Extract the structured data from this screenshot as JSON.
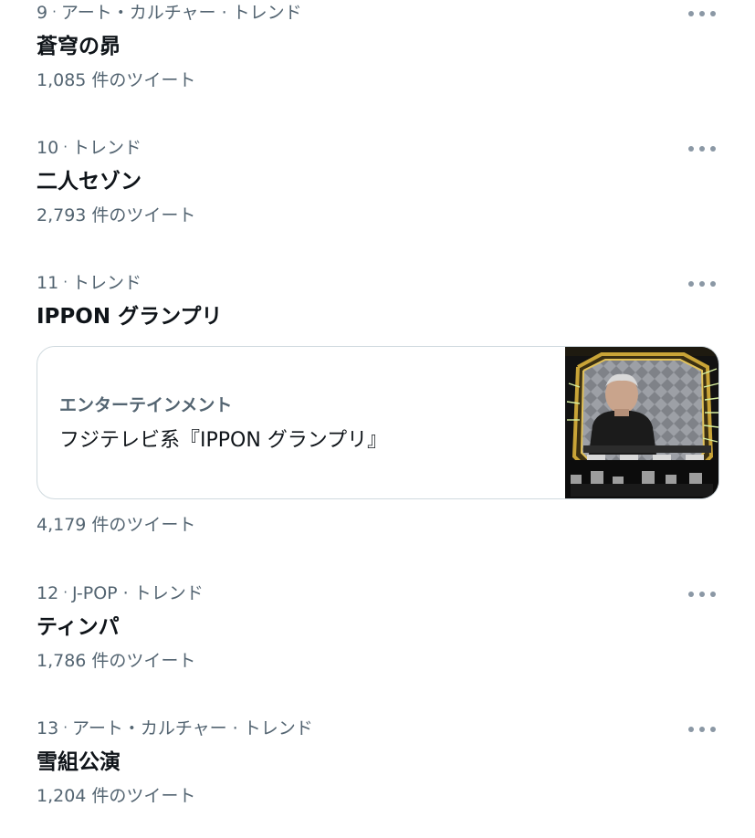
{
  "trends": [
    {
      "rank": "9",
      "category": "アート・カルチャー · トレンド",
      "name": "蒼穹の昴",
      "count": "1,085 件のツイート"
    },
    {
      "rank": "10",
      "category": "トレンド",
      "name": "二人セゾン",
      "count": "2,793 件のツイート"
    },
    {
      "rank": "11",
      "category": "トレンド",
      "name": "IPPON グランプリ",
      "card": {
        "category": "エンターテインメント",
        "title": "フジテレビ系『IPPON グランプリ』",
        "thumbnail": "tv-show-host-photo"
      },
      "count": "4,179 件のツイート"
    },
    {
      "rank": "12",
      "category": "J-POP · トレンド",
      "name": "ティンパ",
      "count": "1,786 件のツイート"
    },
    {
      "rank": "13",
      "category": "アート・カルチャー · トレンド",
      "name": "雪組公演",
      "count": "1,204 件のツイート"
    }
  ],
  "icons": {
    "more": "more-horizontal-icon"
  },
  "colors": {
    "text_primary": "#0f1419",
    "text_secondary": "#536471",
    "border": "#cfd9de",
    "icon": "#8b98a5"
  }
}
